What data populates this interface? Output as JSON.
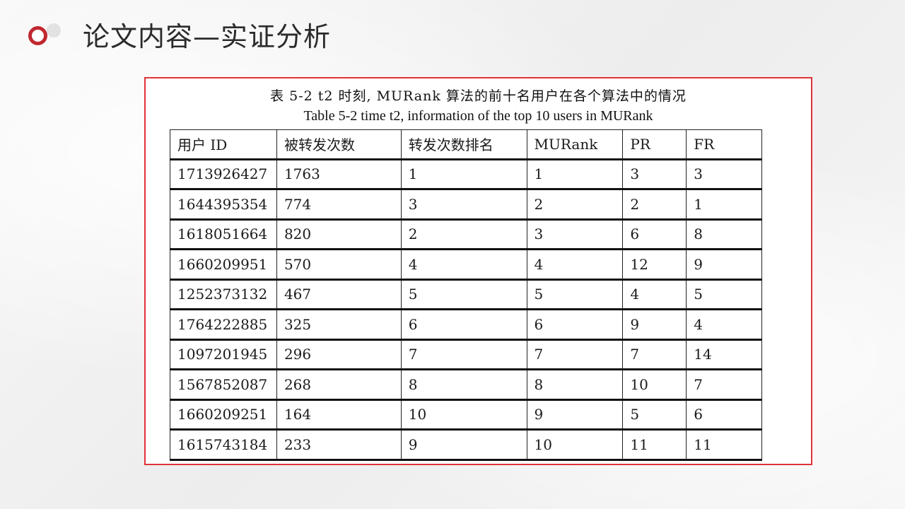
{
  "slide": {
    "title": "论文内容—实证分析"
  },
  "figure": {
    "caption_cn": "表 5-2 t2 时刻, MURank 算法的前十名用户在各个算法中的情况",
    "caption_en": "Table 5-2 time t2, information of the top 10 users in MURank",
    "table": {
      "headers": [
        "用户 ID",
        "被转发次数",
        "转发次数排名",
        "MURank",
        "PR",
        "FR"
      ],
      "rows": [
        [
          "1713926427",
          "1763",
          "1",
          "1",
          "3",
          "3"
        ],
        [
          "1644395354",
          "774",
          "3",
          "2",
          "2",
          "1"
        ],
        [
          "1618051664",
          "820",
          "2",
          "3",
          "6",
          "8"
        ],
        [
          "1660209951",
          "570",
          "4",
          "4",
          "12",
          "9"
        ],
        [
          "1252373132",
          "467",
          "5",
          "5",
          "4",
          "5"
        ],
        [
          "1764222885",
          "325",
          "6",
          "6",
          "9",
          "4"
        ],
        [
          "1097201945",
          "296",
          "7",
          "7",
          "7",
          "14"
        ],
        [
          "1567852087",
          "268",
          "8",
          "8",
          "10",
          "7"
        ],
        [
          "1660209251",
          "164",
          "10",
          "9",
          "5",
          "6"
        ],
        [
          "1615743184",
          "233",
          "9",
          "10",
          "11",
          "11"
        ]
      ]
    }
  },
  "colors": {
    "accent": "#c0282f",
    "frame": "#e0333a"
  },
  "icons": {
    "logo": "ring-bullet-icon"
  }
}
